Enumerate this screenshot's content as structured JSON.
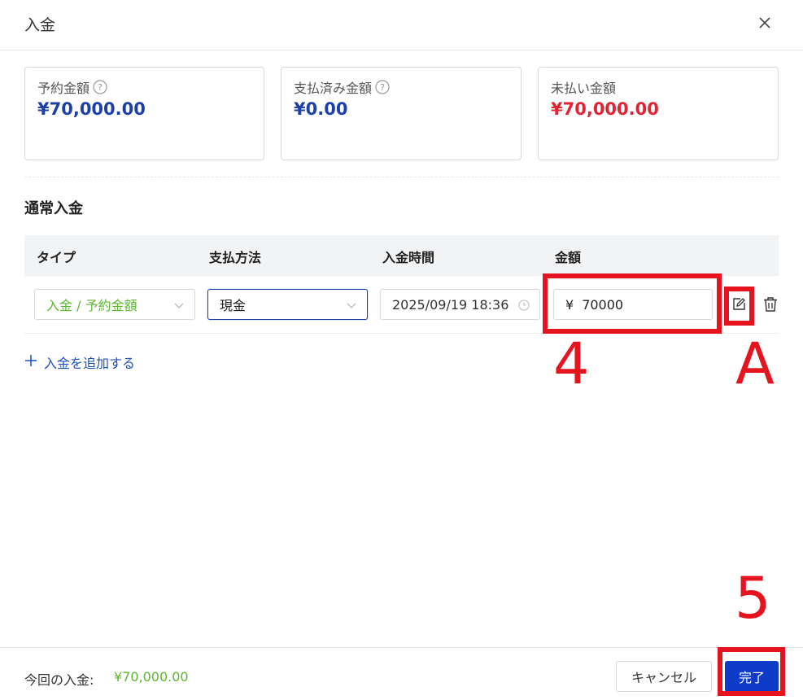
{
  "dialog": {
    "title": "入金"
  },
  "summary": {
    "reserved": {
      "label": "予約金額",
      "value": "¥70,000.00"
    },
    "paid": {
      "label": "支払済み金額",
      "value": "¥0.00"
    },
    "unpaid": {
      "label": "未払い金額",
      "value": "¥70,000.00"
    }
  },
  "section": {
    "title": "通常入金"
  },
  "table": {
    "headers": [
      "タイプ",
      "支払方法",
      "入金時間",
      "金額"
    ],
    "row": {
      "type": "入金 / 予約金額",
      "method": "現金",
      "time": "2025/09/19 18:36",
      "currency": "¥",
      "amount": "70000"
    }
  },
  "add_link": {
    "label": "入金を追加する"
  },
  "annotations": {
    "amount": "4",
    "edit": "A",
    "done": "5"
  },
  "footer": {
    "label": "今回の入金:",
    "amount": "¥70,000.00",
    "cancel": "キャンセル",
    "ok": "完了"
  },
  "colors": {
    "primary_blue": "#0e3cc8",
    "amount_blue": "#1d3fa8",
    "unpaid_red": "#e02433",
    "type_green": "#5cb82e",
    "annotation_red": "#e6141e"
  },
  "icons": [
    "close-icon",
    "help-icon",
    "chevron-down-icon",
    "clock-icon",
    "plus-icon",
    "edit-icon",
    "trash-icon"
  ]
}
